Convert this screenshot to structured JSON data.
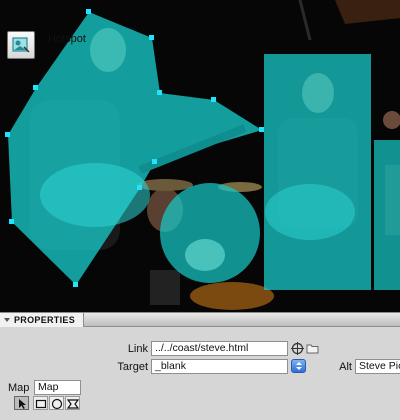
{
  "panel": {
    "tab_label": "PROPERTIES",
    "element_type": "Hotspot",
    "link_label": "Link",
    "link_value": "../../coast/steve.html",
    "target_label": "Target",
    "target_value": "_blank",
    "alt_label": "Alt",
    "alt_value": "Steve Pick",
    "map_label": "Map",
    "map_value": "Map"
  },
  "icons": {
    "hotspot": "hotspot-icon",
    "point_to_file": "crosshair-icon",
    "browse": "folder-icon",
    "pointer_tool": "arrow-pointer-icon",
    "rect_tool": "rectangle-hotspot-icon",
    "circle_tool": "circle-hotspot-icon",
    "polygon_tool": "polygon-hotspot-icon"
  },
  "colors": {
    "hotspot_fill": "#18c8c8",
    "handle": "#1fe3ff",
    "select_accent": "#2f6fd6"
  }
}
